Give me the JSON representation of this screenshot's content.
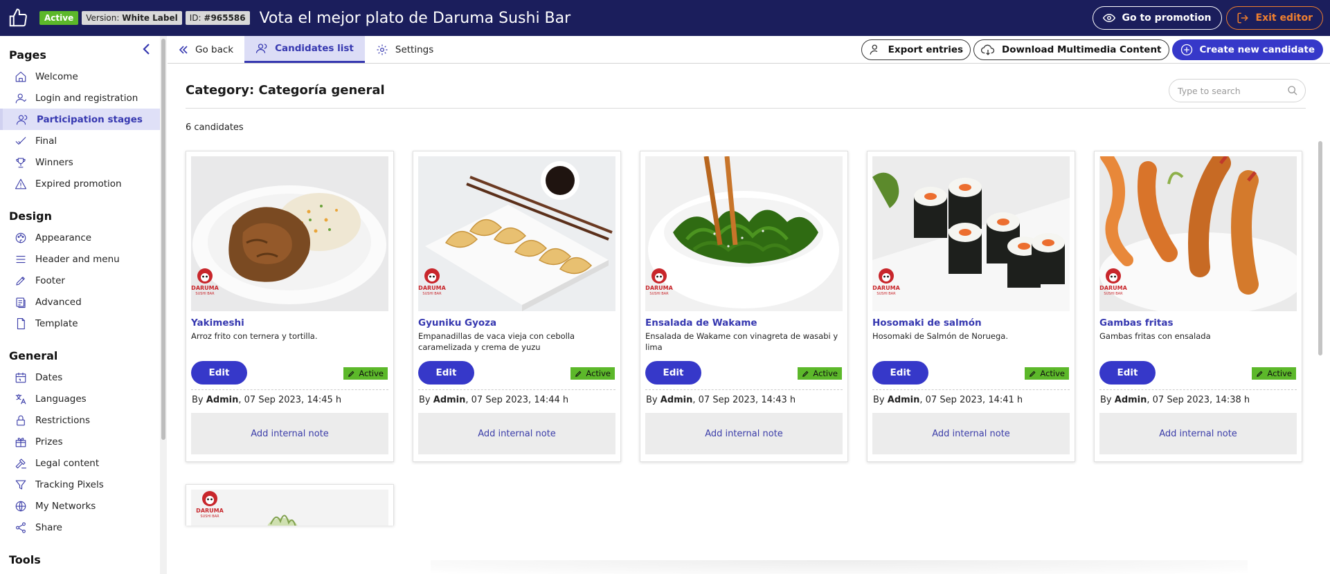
{
  "topbar": {
    "status_badge": "Active",
    "version_label": "Version:",
    "version_value": "White Label",
    "id_label": "ID:",
    "id_value": "#965586",
    "title": "Vota el mejor plato de Daruma Sushi Bar",
    "go_to_promotion": "Go to promotion",
    "exit_editor": "Exit editor"
  },
  "sidebar": {
    "sections": [
      {
        "title": "Pages",
        "items": [
          {
            "label": "Welcome",
            "icon": "home-icon"
          },
          {
            "label": "Login and registration",
            "icon": "user-icon"
          },
          {
            "label": "Participation stages",
            "icon": "users-icon",
            "active": true
          },
          {
            "label": "Final",
            "icon": "check-icon"
          },
          {
            "label": "Winners",
            "icon": "trophy-icon"
          },
          {
            "label": "Expired promotion",
            "icon": "warning-icon"
          }
        ]
      },
      {
        "title": "Design",
        "items": [
          {
            "label": "Appearance",
            "icon": "palette-icon"
          },
          {
            "label": "Header and menu",
            "icon": "menu-icon"
          },
          {
            "label": "Footer",
            "icon": "pen-icon"
          },
          {
            "label": "Advanced",
            "icon": "code-icon"
          },
          {
            "label": "Template",
            "icon": "file-icon"
          }
        ]
      },
      {
        "title": "General",
        "items": [
          {
            "label": "Dates",
            "icon": "calendar-icon"
          },
          {
            "label": "Languages",
            "icon": "translate-icon"
          },
          {
            "label": "Restrictions",
            "icon": "lock-icon"
          },
          {
            "label": "Prizes",
            "icon": "gift-icon"
          },
          {
            "label": "Legal content",
            "icon": "gavel-icon"
          },
          {
            "label": "Tracking Pixels",
            "icon": "filter-icon"
          },
          {
            "label": "My Networks",
            "icon": "globe-icon"
          },
          {
            "label": "Share",
            "icon": "share-icon"
          }
        ]
      },
      {
        "title": "Tools",
        "items": []
      }
    ]
  },
  "toolbar": {
    "go_back": "Go back",
    "candidates_list": "Candidates list",
    "settings": "Settings",
    "export_entries": "Export entries",
    "download_multimedia": "Download Multimedia Content",
    "create_candidate": "Create new candidate"
  },
  "main": {
    "category_title": "Category: Categoría general",
    "search_placeholder": "Type to search",
    "count": "6 candidates",
    "edit_label": "Edit",
    "status_label": "Active",
    "by_label": "By",
    "add_note_label": "Add internal note",
    "brand_label": "DARUMA",
    "brand_sub": "SUSHI BAR",
    "candidates": [
      {
        "name": "Yakimeshi",
        "description": "Arroz frito con ternera y tortilla.",
        "author": "Admin",
        "date": ", 07 Sep 2023, 14:45 h",
        "image": "fried-rice-plate"
      },
      {
        "name": "Gyuniku Gyoza",
        "description": "Empanadillas de vaca vieja con cebolla caramelizada y crema de yuzu",
        "author": "Admin",
        "date": ", 07 Sep 2023, 14:44 h",
        "image": "gyoza-plate"
      },
      {
        "name": "Ensalada de Wakame",
        "description": "Ensalada de Wakame con vinagreta de wasabi y lima",
        "author": "Admin",
        "date": ", 07 Sep 2023, 14:43 h",
        "image": "wakame-bowl"
      },
      {
        "name": "Hosomaki de salmón",
        "description": "Hosomaki de Salmón de Noruega.",
        "author": "Admin",
        "date": ", 07 Sep 2023, 14:41 h",
        "image": "hosomaki-plate"
      },
      {
        "name": "Gambas fritas",
        "description": "Gambas fritas con ensalada",
        "author": "Admin",
        "date": ", 07 Sep 2023, 14:38 h",
        "image": "fried-shrimp-plate"
      }
    ]
  },
  "colors": {
    "topbar": "#1b1e5c",
    "primary": "#3638c9",
    "active_green": "#5cb82a",
    "exit_orange": "#f07f2e"
  }
}
